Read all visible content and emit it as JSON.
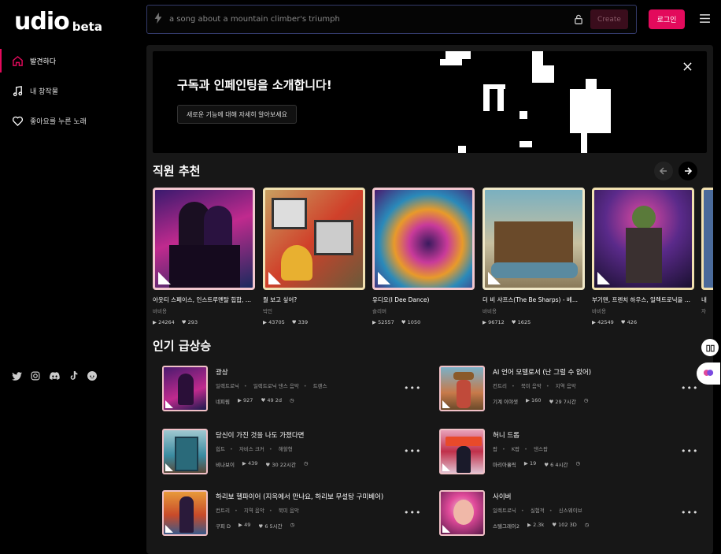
{
  "logo": {
    "main": "udio",
    "sub": "beta"
  },
  "nav": [
    {
      "label": "발견하다",
      "icon": "home-icon"
    },
    {
      "label": "내 창작물",
      "icon": "music-note-icon"
    },
    {
      "label": "좋아요를 누른 노래",
      "icon": "heart-icon"
    }
  ],
  "social": [
    "twitter-icon",
    "instagram-icon",
    "discord-icon",
    "tiktok-icon",
    "reddit-icon"
  ],
  "search": {
    "placeholder": "a song about a mountain climber's triumph",
    "value": ""
  },
  "topbar": {
    "create_label": "Create",
    "login_label": "로그인"
  },
  "banner": {
    "title": "구독과 인페인팅을 소개합니다!",
    "button_label": "새로운 기능에 대해 자세히 알아보세요"
  },
  "staff_picks": {
    "title": "직원 추천",
    "cards": [
      {
        "title": "아웃티 스페이스, 인스트루멘탈 힙합, ...",
        "artist": "바비용",
        "plays": "24264",
        "likes": "293"
      },
      {
        "title": "뭘 보고 싶어?",
        "artist": "박민",
        "plays": "43705",
        "likes": "339"
      },
      {
        "title": "유디오(I Dee Dance)",
        "artist": "슬리버",
        "plays": "52557",
        "likes": "1050"
      },
      {
        "title": "더 비 샤프스(The Be Sharps) - 베...",
        "artist": "바비용",
        "plays": "96712",
        "likes": "1625"
      },
      {
        "title": "부기맨, 프렌치 하우스, 일렉트로닉을 ...",
        "artist": "바비용",
        "plays": "42549",
        "likes": "426"
      },
      {
        "title": "내",
        "artist": "자",
        "plays": "",
        "likes": ""
      }
    ]
  },
  "trending": {
    "title": "인기 급상승",
    "items": [
      {
        "title": "광상",
        "tags": [
          "일렉트로닉",
          "일렉트로닉 댄스 음악",
          "트랜스"
        ],
        "artist": "네피림",
        "plays": "927",
        "likes": "49",
        "age": "2d"
      },
      {
        "title": "AI 언어 모델로서 (난 그럴 수 없어)",
        "tags": [
          "컨트리",
          "북미 음악",
          "지역 음악"
        ],
        "artist": "기계 이야샛",
        "plays": "160",
        "likes": "29",
        "age": "7시간"
      },
      {
        "title": "당신이 가진 것을 나도 가졌다면",
        "tags": [
          "힙트",
          "자비스 크커",
          "해할형"
        ],
        "artist": "비나보이",
        "plays": "439",
        "likes": "30",
        "age": "22시간"
      },
      {
        "title": "허니 드롭",
        "tags": [
          "팝",
          "K팝",
          "댄스팝"
        ],
        "artist": "마리아흘릭",
        "plays": "19",
        "likes": "6",
        "age": "4시간"
      },
      {
        "title": "하리보 헬파이어 (지옥에서 만나요, 하리보 무설탕 구미베어)",
        "tags": [
          "컨트리",
          "지역 음악",
          "북미 음악"
        ],
        "artist": "구피 D",
        "plays": "49",
        "likes": "6",
        "age": "5시간"
      },
      {
        "title": "사이버",
        "tags": [
          "일렉트로닉",
          "실험적",
          "신스웨이브"
        ],
        "artist": "스텔그레이2",
        "plays": "2.3k",
        "likes": "102",
        "age": "3D"
      }
    ]
  },
  "colors": {
    "accent": "#e30a5c",
    "panel": "#171717"
  }
}
